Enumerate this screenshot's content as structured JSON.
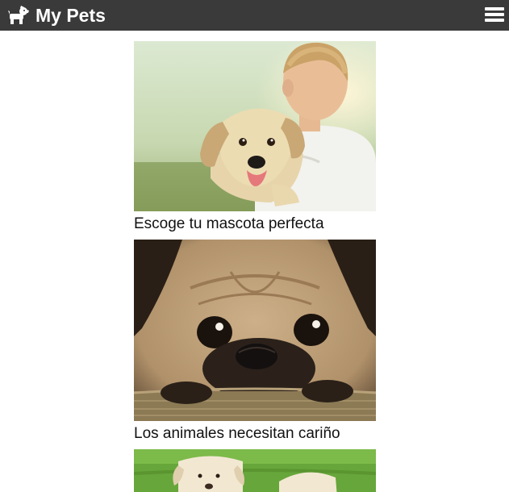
{
  "header": {
    "brand_icon": "dog-icon",
    "title": "My Pets",
    "menu_icon": "hamburger-menu-icon"
  },
  "feed": {
    "cards": [
      {
        "image": "puppy-hugging-boy-photo",
        "caption": "Escoge tu mascota perfecta"
      },
      {
        "image": "sad-pug-photo",
        "caption": "Los animales necesitan cariño"
      },
      {
        "image": "labrador-on-grass-photo",
        "caption": ""
      }
    ]
  },
  "colors": {
    "navbar_bg": "#3a3a3a",
    "navbar_text": "#ffffff",
    "caption_text": "#111111"
  }
}
